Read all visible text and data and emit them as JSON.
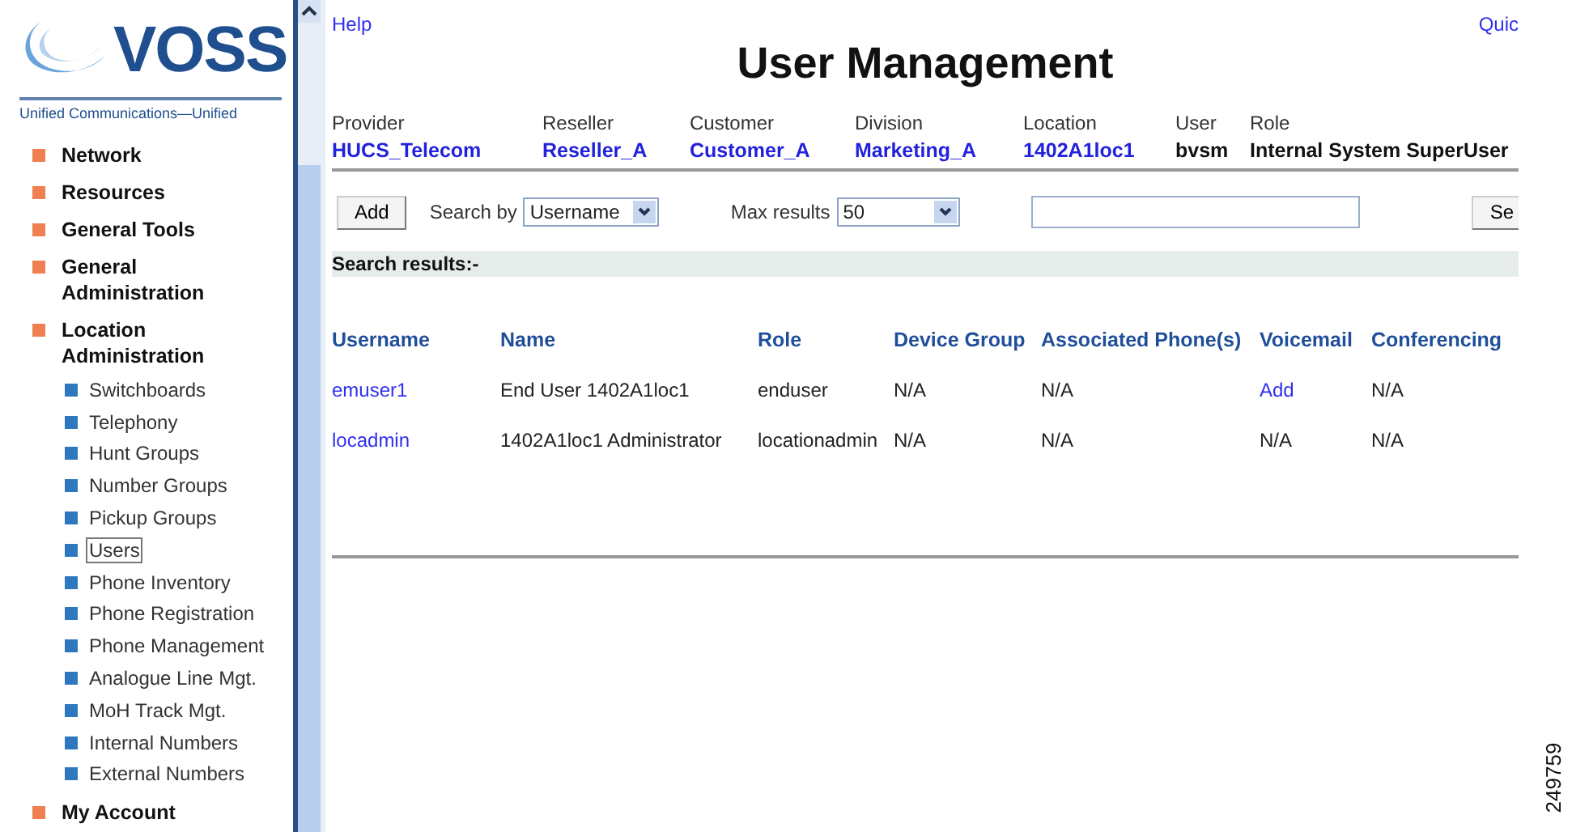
{
  "logo": {
    "name": "VOSS",
    "tagline": "Unified Communications—Unified"
  },
  "sidebar": {
    "items": [
      {
        "label": "Network"
      },
      {
        "label": "Resources"
      },
      {
        "label": "General Tools"
      },
      {
        "label": "General Administration"
      },
      {
        "label": "Location Administration",
        "children": [
          {
            "label": "Switchboards",
            "selected": false
          },
          {
            "label": "Telephony",
            "selected": false
          },
          {
            "label": "Hunt Groups",
            "selected": false
          },
          {
            "label": "Number Groups",
            "selected": false
          },
          {
            "label": "Pickup Groups",
            "selected": false
          },
          {
            "label": "Users",
            "selected": true
          },
          {
            "label": "Phone Inventory",
            "selected": false
          },
          {
            "label": "Phone Registration",
            "selected": false
          },
          {
            "label": "Phone Management",
            "selected": false
          },
          {
            "label": "Analogue Line Mgt.",
            "selected": false
          },
          {
            "label": "MoH Track Mgt.",
            "selected": false
          },
          {
            "label": "Internal Numbers",
            "selected": false
          },
          {
            "label": "External Numbers",
            "selected": false
          }
        ]
      },
      {
        "label": "My Account"
      }
    ]
  },
  "help_link": "Help",
  "quick_link": "Quic",
  "title": "User Management",
  "context": [
    {
      "label": "Provider",
      "value": "HUCS_Telecom",
      "kind": "link"
    },
    {
      "label": "Reseller",
      "value": "Reseller_A",
      "kind": "link"
    },
    {
      "label": "Customer",
      "value": "Customer_A",
      "kind": "link"
    },
    {
      "label": "Division",
      "value": "Marketing_A",
      "kind": "link"
    },
    {
      "label": "Location",
      "value": "1402A1loc1",
      "kind": "link"
    },
    {
      "label": "User",
      "value": "bvsm",
      "kind": "plain"
    },
    {
      "label": "Role",
      "value": "Internal System SuperUser",
      "kind": "plain"
    }
  ],
  "toolbar": {
    "add_button": "Add",
    "search_by_label": "Search by",
    "search_by_value": "Username",
    "max_results_label": "Max results",
    "max_results_value": "50",
    "search_button": "Se"
  },
  "results_heading": "Search results:-",
  "table": {
    "columns": [
      "Username",
      "Name",
      "Role",
      "Device Group",
      "Associated Phone(s)",
      "Voicemail",
      "Conferencing"
    ],
    "rows": [
      {
        "cells": [
          {
            "text": "emuser1",
            "kind": "link"
          },
          {
            "text": "End User 1402A1loc1",
            "kind": "plain"
          },
          {
            "text": "enduser",
            "kind": "plain"
          },
          {
            "text": "N/A",
            "kind": "plain"
          },
          {
            "text": "N/A",
            "kind": "plain"
          },
          {
            "text": "Add",
            "kind": "link"
          },
          {
            "text": "N/A",
            "kind": "plain"
          }
        ]
      },
      {
        "cells": [
          {
            "text": "locadmin",
            "kind": "link"
          },
          {
            "text": "1402A1loc1 Administrator",
            "kind": "plain"
          },
          {
            "text": "locationadmin",
            "kind": "plain"
          },
          {
            "text": "N/A",
            "kind": "plain"
          },
          {
            "text": "N/A",
            "kind": "plain"
          },
          {
            "text": "N/A",
            "kind": "plain"
          },
          {
            "text": "N/A",
            "kind": "plain"
          }
        ]
      }
    ]
  },
  "figure_number": "249759"
}
